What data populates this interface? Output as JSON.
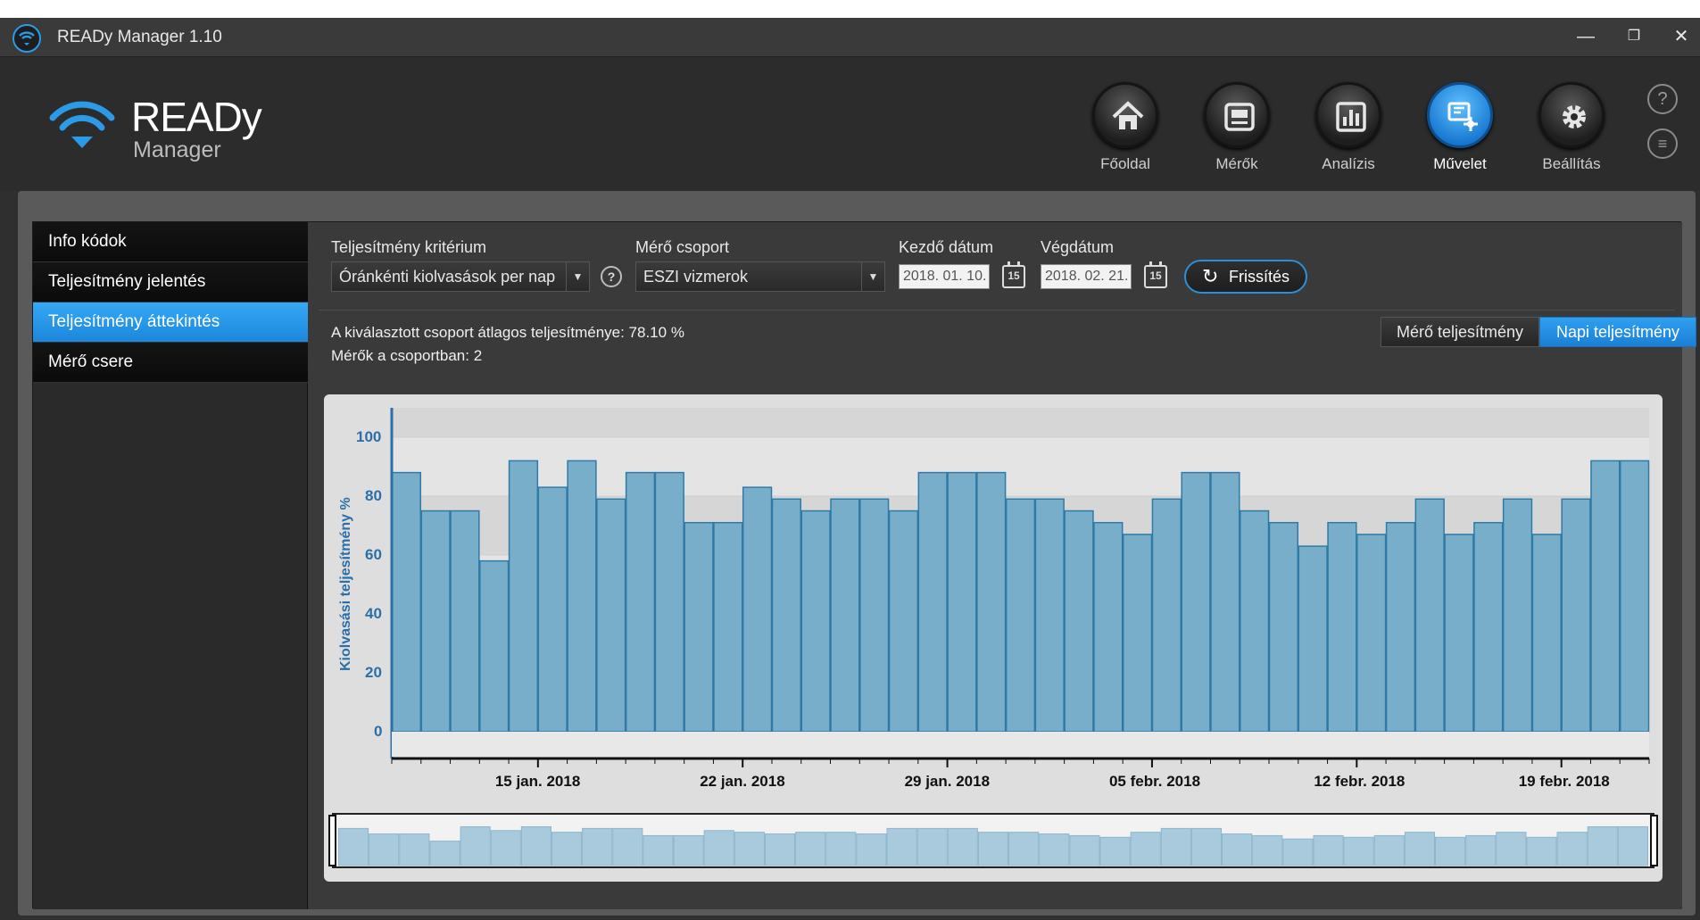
{
  "window": {
    "title": "READy Manager 1.10",
    "controls": {
      "minimize": "—",
      "restore": "❐",
      "close": "✕"
    }
  },
  "logo": {
    "ready": "READy",
    "manager": "Manager"
  },
  "nav": [
    {
      "label": "Főoldal",
      "icon": "home-icon"
    },
    {
      "label": "Mérők",
      "icon": "meter-icon"
    },
    {
      "label": "Analízis",
      "icon": "chart-icon"
    },
    {
      "label": "Művelet",
      "icon": "operation-icon",
      "active": true
    },
    {
      "label": "Beállítás",
      "icon": "gear-icon"
    }
  ],
  "side_icons": {
    "help": "?",
    "list": "≡"
  },
  "sidebar": {
    "items": [
      {
        "label": "Info kódok"
      },
      {
        "label": "Teljesítmény jelentés"
      },
      {
        "label": "Teljesítmény áttekintés",
        "active": true
      },
      {
        "label": "Mérő csere"
      }
    ]
  },
  "filters": {
    "criterion_label": "Teljesítmény kritérium",
    "criterion_value": "Óránkénti kiolvasások per nap",
    "help": "?",
    "group_label": "Mérő csoport",
    "group_value": "ESZI vizmerok",
    "start_label": "Kezdő dátum",
    "start_value": "2018. 01. 10.",
    "end_label": "Végdátum",
    "end_value": "2018. 02. 21.",
    "cal_day": "15",
    "refresh_label": "Frissítés"
  },
  "info": {
    "avg_line": "A kiválasztott csoport átlagos teljesítménye: 78.10 %",
    "count_line": "Mérők a csoportban: 2"
  },
  "toggles": {
    "meter": "Mérő teljesítmény",
    "daily": "Napi teljesítmény"
  },
  "colors": {
    "accent": "#1f8ae0",
    "bar_fill": "#79aecb",
    "bar_stroke": "#2f7aa6",
    "axis": "#2b6ea8"
  },
  "chart_data": {
    "type": "bar",
    "ylabel": "Kiolvasási teljesítmény %",
    "ylim": [
      0,
      110
    ],
    "yticks": [
      "0",
      "20",
      "40",
      "60",
      "80",
      "100"
    ],
    "x_start": "2018-01-10",
    "x_end": "2018-02-21",
    "xtick_labels": [
      "15 jan. 2018",
      "22 jan. 2018",
      "29 jan. 2018",
      "05 febr. 2018",
      "12 febr. 2018",
      "19 febr. 2018"
    ],
    "grid": true,
    "series": [
      {
        "values": [
          88,
          75,
          75,
          58,
          92,
          83,
          92,
          79,
          88,
          88,
          71,
          71,
          83,
          79,
          75,
          79,
          79,
          75,
          88,
          88,
          88,
          79,
          79,
          75,
          71,
          67,
          79,
          88,
          88,
          75,
          71,
          63,
          71,
          67,
          71,
          79,
          67,
          71,
          79,
          67,
          79,
          92,
          92
        ]
      }
    ]
  }
}
